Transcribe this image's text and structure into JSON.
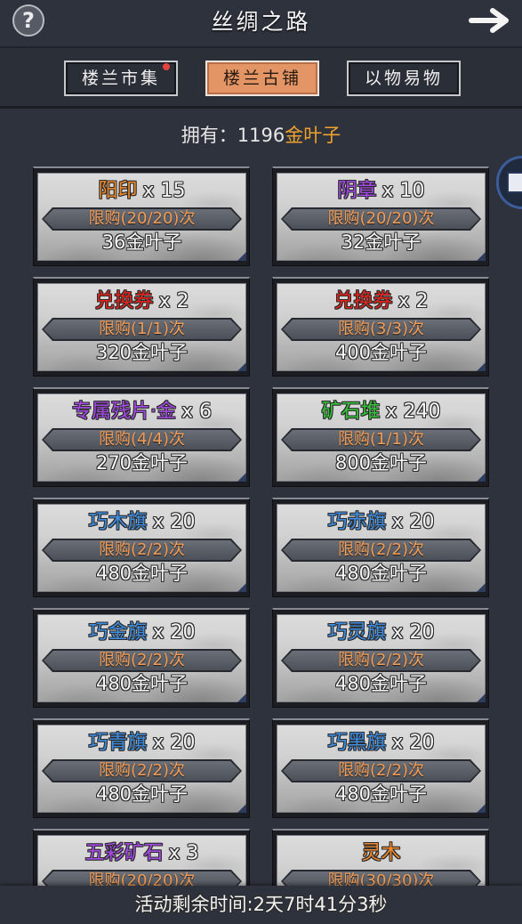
{
  "header": {
    "title": "丝绸之路",
    "help_label": "?",
    "help_icon": "help-icon",
    "forward_icon": "arrow-right-icon"
  },
  "tabs": [
    {
      "label": "楼兰市集",
      "selected": false,
      "badge": true
    },
    {
      "label": "楼兰古铺",
      "selected": true,
      "badge": false
    },
    {
      "label": "以物易物",
      "selected": false,
      "badge": false
    }
  ],
  "balance": {
    "prefix": "拥有：",
    "amount": "1196",
    "currency": "金叶子"
  },
  "side_button": {
    "icon": "scroll-book-icon"
  },
  "colors": {
    "background": "#2e323c",
    "selected_tab": "#e39566",
    "currency": "#f0a22e",
    "limit_text": "#f39c55",
    "badge": "#e5413e",
    "quantity_text": "#f4f4f4"
  },
  "items": [
    {
      "name": "阳印",
      "quantity": "x 15",
      "name_color": "#ef8a2c",
      "limit": "限购(20/20)次",
      "price": "36金叶子"
    },
    {
      "name": "阴章",
      "quantity": "x 10",
      "name_color": "#a54ae6",
      "limit": "限购(20/20)次",
      "price": "32金叶子"
    },
    {
      "name": "兑换券",
      "quantity": "x 2",
      "name_color": "#e5231d",
      "limit": "限购(1/1)次",
      "price": "320金叶子"
    },
    {
      "name": "兑换券",
      "quantity": "x 2",
      "name_color": "#e5231d",
      "limit": "限购(3/3)次",
      "price": "400金叶子"
    },
    {
      "name": "专属残片·金",
      "quantity": "x 6",
      "name_color": "#a54ae6",
      "limit": "限购(4/4)次",
      "price": "270金叶子"
    },
    {
      "name": "矿石堆",
      "quantity": "x 240",
      "name_color": "#36c23a",
      "limit": "限购(1/1)次",
      "price": "800金叶子"
    },
    {
      "name": "巧木旗",
      "quantity": "x 20",
      "name_color": "#3e8fe4",
      "limit": "限购(2/2)次",
      "price": "480金叶子"
    },
    {
      "name": "巧赤旗",
      "quantity": "x 20",
      "name_color": "#3e8fe4",
      "limit": "限购(2/2)次",
      "price": "480金叶子"
    },
    {
      "name": "巧金旗",
      "quantity": "x 20",
      "name_color": "#3e8fe4",
      "limit": "限购(2/2)次",
      "price": "480金叶子"
    },
    {
      "name": "巧灵旗",
      "quantity": "x 20",
      "name_color": "#3e8fe4",
      "limit": "限购(2/2)次",
      "price": "480金叶子"
    },
    {
      "name": "巧青旗",
      "quantity": "x 20",
      "name_color": "#3e8fe4",
      "limit": "限购(2/2)次",
      "price": "480金叶子"
    },
    {
      "name": "巧黑旗",
      "quantity": "x 20",
      "name_color": "#3e8fe4",
      "limit": "限购(2/2)次",
      "price": "480金叶子"
    },
    {
      "name": "五彩矿石",
      "quantity": "x 3",
      "name_color": "#a54ae6",
      "limit": "限购(20/20)次"
    },
    {
      "name": "灵木",
      "name_color": "#ef8a2c",
      "limit": "限购(30/30)次"
    }
  ],
  "footer": {
    "countdown": "活动剩余时间:2天7时41分3秒"
  }
}
